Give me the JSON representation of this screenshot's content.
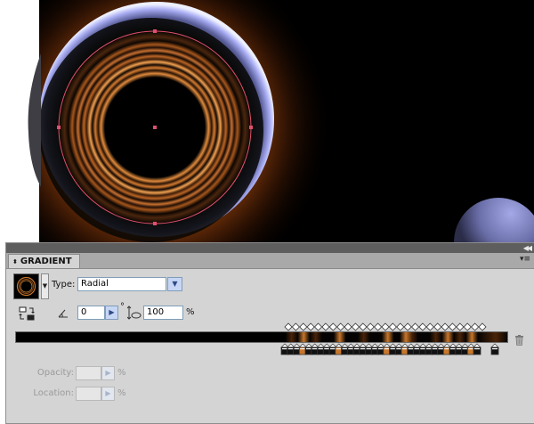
{
  "panel": {
    "tab_label": "GRADIENT",
    "tab_arrows_icon": "updown-arrows-icon",
    "collapse_icon": "double-chevron-icon",
    "menu_icon": "panel-menu-icon"
  },
  "gradient": {
    "type_label": "Type:",
    "type_value": "Radial",
    "angle_value": "0",
    "angle_unit": "°",
    "aspect_value": "100",
    "aspect_unit": "%",
    "opacity_label": "Opacity:",
    "opacity_unit": "%",
    "location_label": "Location:",
    "location_unit": "%",
    "stop_count": 34,
    "midpoint_count": 27
  },
  "colors": {
    "panel_bg": "#d4d4d4",
    "canvas_bg": "#000000",
    "stop_orange": "#c8762a",
    "stop_black": "#111111",
    "selection_pink": "#e0506e",
    "glow_orange": "#c85a10",
    "rim_blue": "#9b9ff0"
  }
}
